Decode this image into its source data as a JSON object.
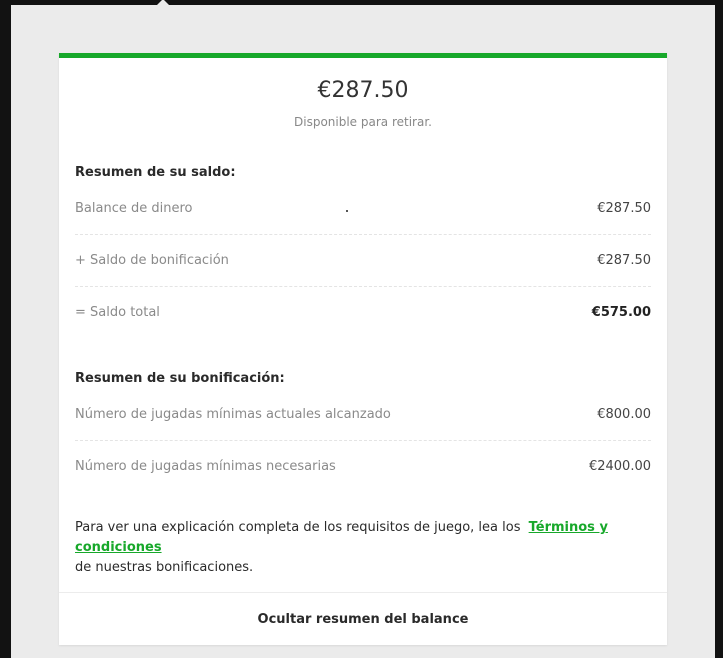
{
  "balance": {
    "amount": "€287.50",
    "subtitle": "Disponible para retirar."
  },
  "balance_summary": {
    "title": "Resumen de su saldo:",
    "rows": [
      {
        "label": "Balance de dinero",
        "value": "€287.50"
      },
      {
        "label": "+ Saldo de bonificación",
        "value": "€287.50"
      },
      {
        "label": "= Saldo total",
        "value": "€575.00"
      }
    ]
  },
  "bonus_summary": {
    "title": "Resumen de su bonificación:",
    "rows": [
      {
        "label": "Número de jugadas mínimas actuales alcanzado",
        "value": "€800.00"
      },
      {
        "label": "Número de jugadas mínimas necesarias",
        "value": "€2400.00"
      }
    ]
  },
  "terms": {
    "text_before": "Para ver una explicación completa de los requisitos de juego, lea los",
    "link": "Términos y condiciones",
    "text_after": "de nuestras bonificaciones."
  },
  "footer": {
    "hide_label": "Ocultar resumen del balance"
  },
  "colors": {
    "accent": "#17a82a",
    "overlay": "#121212",
    "panel": "#ebebeb"
  }
}
